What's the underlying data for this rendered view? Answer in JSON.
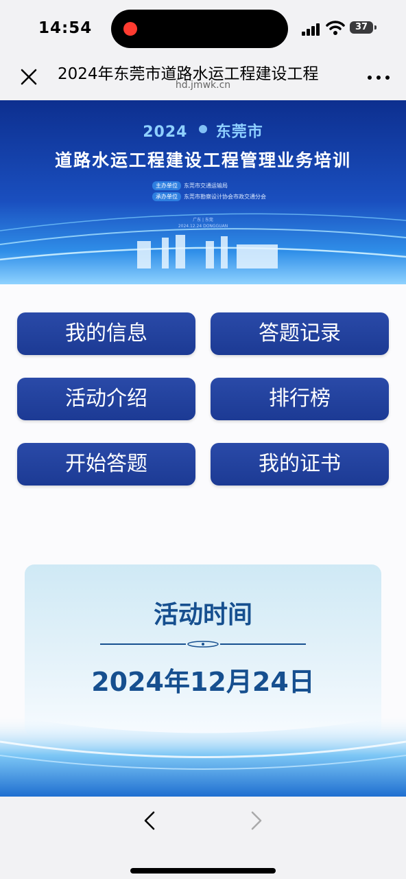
{
  "status": {
    "time": "14:54",
    "battery": "37"
  },
  "navbar": {
    "title": "2024年东莞市道路水运工程建设工程",
    "domain": "hd.jmwk.cn"
  },
  "banner": {
    "year": "2024",
    "city": "东莞市",
    "main_title": "道路水运工程建设工程管理业务培训",
    "host_label": "主办单位",
    "host": "东莞市交通运输局",
    "organizer_label": "承办单位",
    "organizer": "东莞市勘察设计协会市政交通分会",
    "location": "广东 | 东莞",
    "date_line": "2024.12.24 DONGGUAN"
  },
  "buttons": {
    "my_info": "我的信息",
    "answer_records": "答题记录",
    "activity_intro": "活动介绍",
    "leaderboard": "排行榜",
    "start_quiz": "开始答题",
    "my_certificate": "我的证书"
  },
  "activity": {
    "heading": "活动时间",
    "date": "2024年12月24日"
  },
  "colors": {
    "button_bg": "#1f3c98",
    "heading_text": "#164f8f",
    "banner_blue": "#0d2f8f"
  }
}
